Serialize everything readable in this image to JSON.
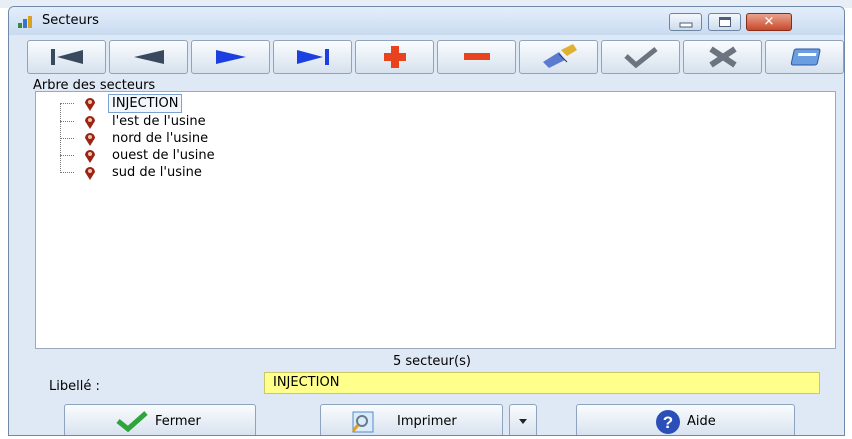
{
  "window": {
    "title": "Secteurs",
    "title_icon": "sectors-app-icon",
    "controls": [
      "minimize-icon",
      "maximize-icon",
      "close-icon"
    ]
  },
  "toolbar": {
    "buttons": [
      {
        "name": "first-record",
        "icon": "first-icon"
      },
      {
        "name": "previous-record",
        "icon": "previous-icon"
      },
      {
        "name": "next-record",
        "icon": "next-icon"
      },
      {
        "name": "last-record",
        "icon": "last-icon"
      },
      {
        "name": "add",
        "icon": "plus-icon"
      },
      {
        "name": "delete",
        "icon": "minus-icon"
      },
      {
        "name": "edit",
        "icon": "brush-icon"
      },
      {
        "name": "validate",
        "icon": "check-icon"
      },
      {
        "name": "cancel",
        "icon": "cross-icon"
      },
      {
        "name": "view",
        "icon": "window-icon"
      }
    ]
  },
  "tree": {
    "label": "Arbre des secteurs",
    "items": [
      {
        "label": "INJECTION",
        "selected": true,
        "icon": "location-pin-icon"
      },
      {
        "label": "l'est de l'usine",
        "selected": false,
        "icon": "location-pin-icon"
      },
      {
        "label": "nord de l'usine",
        "selected": false,
        "icon": "location-pin-icon"
      },
      {
        "label": "ouest de l'usine",
        "selected": false,
        "icon": "location-pin-icon"
      },
      {
        "label": "sud de l'usine",
        "selected": false,
        "icon": "location-pin-icon"
      }
    ]
  },
  "status": {
    "count_text": "5  secteur(s)"
  },
  "form": {
    "libelle_label": "Libellé :",
    "libelle_value": "INJECTION"
  },
  "buttons": {
    "fermer": "Fermer",
    "imprimer": "Imprimer",
    "aide": "Aide"
  },
  "colors": {
    "accent_blue": "#1b3fe0",
    "delete_red": "#e8421f",
    "field_yellow": "#ffff8c"
  }
}
